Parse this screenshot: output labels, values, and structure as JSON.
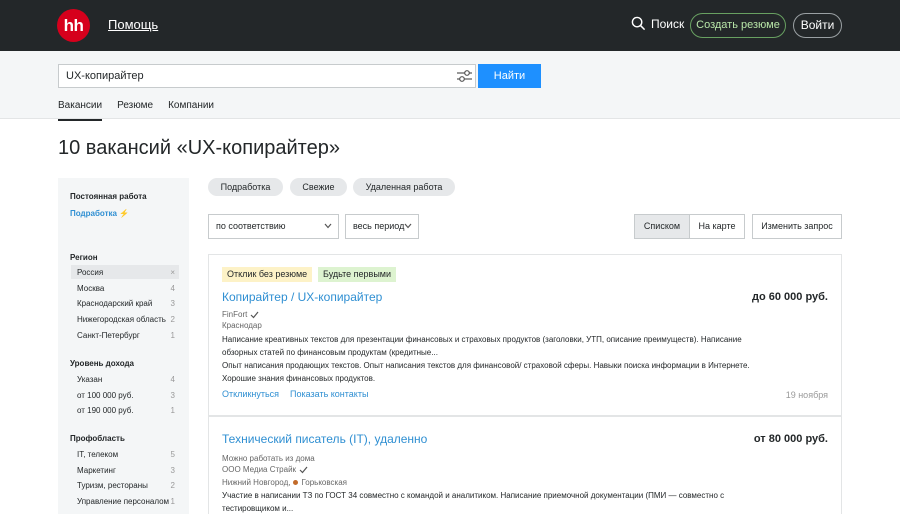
{
  "header": {
    "logo_text": "hh",
    "help": "Помощь",
    "search": "Поиск",
    "create_resume": "Создать резюме",
    "login": "Войти"
  },
  "search": {
    "query": "UX-копирайтер",
    "find_button": "Найти",
    "tabs": [
      "Вакансии",
      "Резюме",
      "Компании"
    ]
  },
  "page_title": "10 вакансий «UX-копирайтер»",
  "sidebar": {
    "employment_title": "Постоянная работа",
    "employment_link": "Подработка ⚡",
    "region_title": "Регион",
    "regions": [
      {
        "name": "Россия",
        "count": "×"
      },
      {
        "name": "Москва",
        "count": "4"
      },
      {
        "name": "Краснодарский край",
        "count": "3"
      },
      {
        "name": "Нижегородская область",
        "count": "2"
      },
      {
        "name": "Санкт-Петербург",
        "count": "1"
      }
    ],
    "income_title": "Уровень дохода",
    "incomes": [
      {
        "name": "Указан",
        "count": "4"
      },
      {
        "name": "от 100 000 руб.",
        "count": "3"
      },
      {
        "name": "от 190 000 руб.",
        "count": "1"
      }
    ],
    "area_title": "Профобласть",
    "areas": [
      {
        "name": "IT, телеком",
        "count": "5"
      },
      {
        "name": "Маркетинг",
        "count": "3"
      },
      {
        "name": "Туризм, рестораны",
        "count": "2"
      },
      {
        "name": "Управление персоналом",
        "count": "1"
      }
    ]
  },
  "chips": [
    "Подработка",
    "Свежие",
    "Удаленная работа"
  ],
  "sort": {
    "order": "по соответствию",
    "period": "весь период",
    "view_list": "Списком",
    "view_map": "На карте",
    "change_query": "Изменить запрос"
  },
  "vacancies": [
    {
      "tags": [
        "Отклик без резюме",
        "Будьте первыми"
      ],
      "title": "Копирайтер / UX-копирайтер",
      "salary": "до 60 000 руб.",
      "company": "FinFort",
      "location": "Краснодар",
      "description": [
        "Написание креативных текстов для презентации финансовых и страховых продуктов (заголовки, УТП, описание преимуществ). Написание",
        "обзорных статей по финансовым продуктам (кредитные...",
        "Опыт написания продающих текстов. Опыт написания текстов для финансовой/ страховой сферы. Навыки поиска информации в Интернете.",
        "Хорошие знания финансовых продуктов."
      ],
      "respond": "Откликнуться",
      "contacts": "Показать контакты",
      "date": "19 ноября"
    },
    {
      "title": "Технический писатель (IT), удаленно",
      "salary": "от 80 000 руб.",
      "remote_note": "Можно работать из дома",
      "company": "ООО Медиа Страйк",
      "location": "Нижний Новгород,",
      "metro": "Горьковская",
      "description": [
        "Участие в написании ТЗ по ГОСТ 34 совместно с командой и аналитиком. Написание приемочной документации (ПМИ — совместно с",
        "тестировщиком и..."
      ]
    }
  ],
  "colors": {
    "topbar": "#232729",
    "logo": "#d6001c",
    "primary": "#1e90ff",
    "link": "#2f8fd2",
    "create_border": "#68a061",
    "tag_yellow": "#fdf2c7",
    "tag_green": "#ddf3d0"
  }
}
